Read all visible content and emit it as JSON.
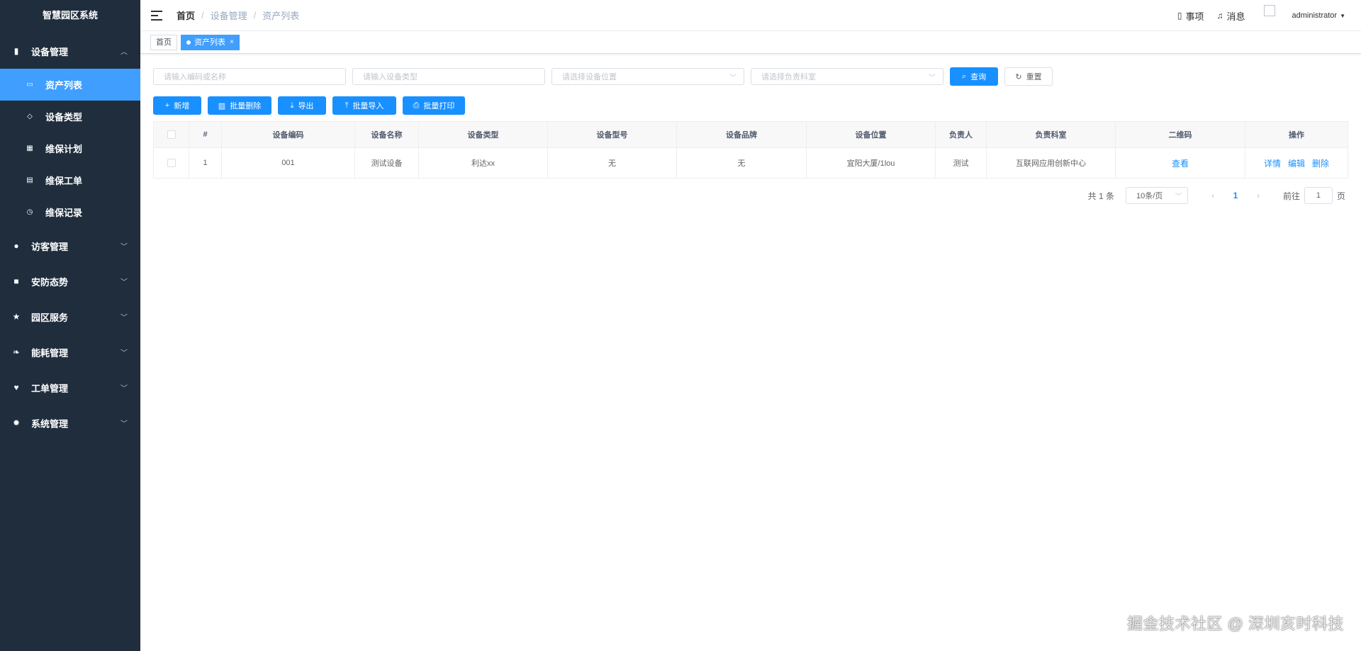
{
  "app": {
    "title": "智慧园区系统"
  },
  "sidebar": {
    "groups": [
      {
        "label": "设备管理",
        "icon": "bookmark-icon",
        "expanded": true,
        "items": [
          {
            "label": "资产列表",
            "icon": "printer-icon",
            "active": true
          },
          {
            "label": "设备类型",
            "icon": "tag-icon"
          },
          {
            "label": "维保计划",
            "icon": "calendar-icon"
          },
          {
            "label": "维保工单",
            "icon": "ticket-icon"
          },
          {
            "label": "维保记录",
            "icon": "history-icon"
          }
        ]
      },
      {
        "label": "访客管理",
        "icon": "user-icon"
      },
      {
        "label": "安防态势",
        "icon": "lock-icon"
      },
      {
        "label": "园区服务",
        "icon": "star-icon"
      },
      {
        "label": "能耗管理",
        "icon": "leaf-icon"
      },
      {
        "label": "工单管理",
        "icon": "heart-icon"
      },
      {
        "label": "系统管理",
        "icon": "gear-icon"
      }
    ]
  },
  "header": {
    "breadcrumb": [
      "首页",
      "设备管理",
      "资产列表"
    ],
    "todo_label": "事项",
    "message_label": "消息",
    "user": "administrator"
  },
  "tags": {
    "home": "首页",
    "active": "资产列表"
  },
  "filters": {
    "code_placeholder": "请输入编码或名称",
    "type_placeholder": "请输入设备类型",
    "location_placeholder": "请选择设备位置",
    "dept_placeholder": "请选择负责科室",
    "search_label": "查询",
    "reset_label": "重置"
  },
  "toolbar": {
    "add_label": "新增",
    "batch_delete_label": "批量删除",
    "export_label": "导出",
    "batch_import_label": "批量导入",
    "batch_print_label": "批量打印"
  },
  "table": {
    "columns": [
      "#",
      "设备编码",
      "设备名称",
      "设备类型",
      "设备型号",
      "设备品牌",
      "设备位置",
      "负责人",
      "负责科室",
      "二维码",
      "操作"
    ],
    "rows": [
      {
        "index": "1",
        "code": "001",
        "name": "测试设备",
        "type": "利达xx",
        "model": "无",
        "brand": "无",
        "location": "宜阳大厦/1lou",
        "owner": "测试",
        "dept": "互联网应用创新中心",
        "qrcode": "查看",
        "detail": "详情",
        "edit": "编辑",
        "delete": "删除"
      }
    ]
  },
  "pagination": {
    "total_label": "共 1 条",
    "page_size": "10条/页",
    "current_page": "1",
    "goto_label": "前往",
    "goto_value": "1",
    "page_unit": "页"
  },
  "watermark": "掘金技术社区 @ 深圳亥时科技",
  "colors": {
    "sidebar_bg": "#1f2d3d",
    "primary": "#1890ff",
    "active_menu": "#409eff"
  }
}
